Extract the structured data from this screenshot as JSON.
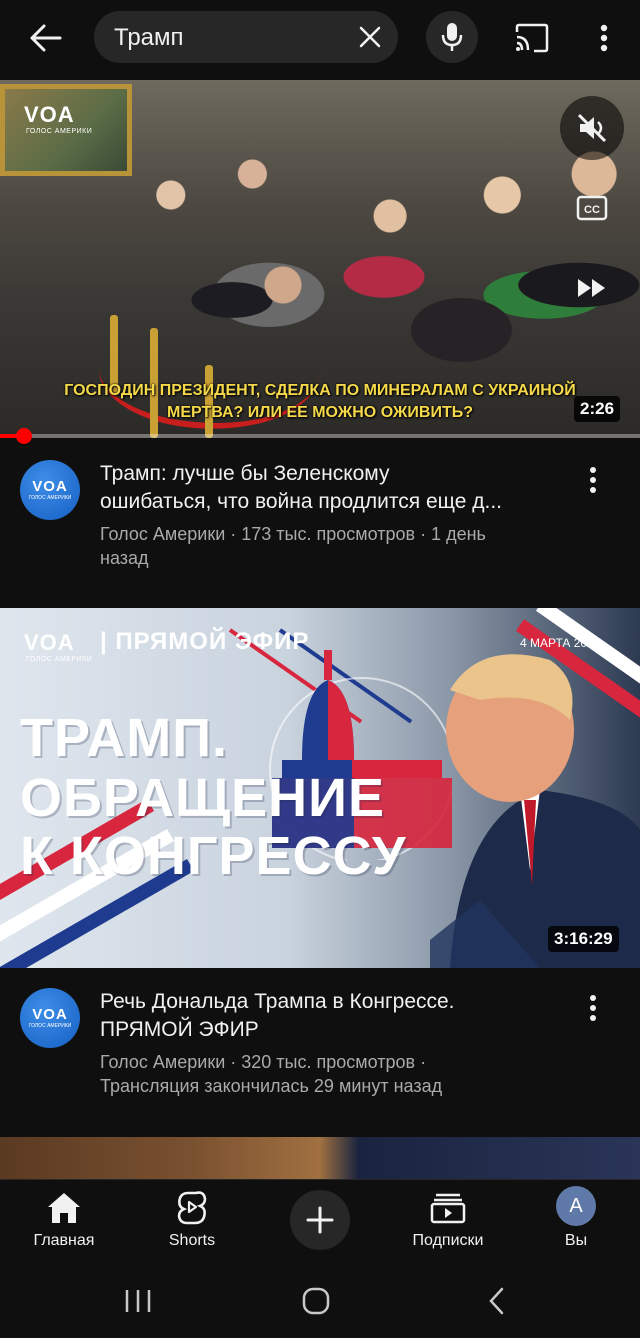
{
  "search": {
    "query": "Трамп"
  },
  "videos": [
    {
      "thumb_logo": "VOA",
      "thumb_logo_sub": "ГОЛОС АМЕРИКИ",
      "subtitle_line1": "ГОСПОДИН ПРЕЗИДЕНТ, СДЕЛКА ПО МИНЕРАЛАМ С УКРАИНОЙ",
      "subtitle_line2": "МЕРТВА? ИЛИ ЕЕ МОЖНО ОЖИВИТЬ?",
      "duration": "2:26",
      "progress_fraction": 0.025,
      "title_line1": "Трамп: лучше бы Зеленскому",
      "title_line2": "ошибаться, что война продлится еще д...",
      "channel": "Голос Америки",
      "views": "173 тыс. просмотров",
      "age": "1 день назад",
      "meta_line": "Голос Америки · 173 тыс. просмотров · 1 день",
      "meta_line2": "назад",
      "avatar_text": "VOA",
      "avatar_sub": "ГОЛОС АМЕРИКИ"
    },
    {
      "thumb_logo": "VOA",
      "thumb_logo_sub": "ГОЛОС АМЕРИКИ",
      "live_label": "| ПРЯМОЙ ЭФИР",
      "date_label": "4 МАРТА 2025",
      "big_title_1": "ТРАМП.",
      "big_title_2": "ОБРАЩЕНИЕ",
      "big_title_3": "К КОНГРЕССУ",
      "duration": "3:16:29",
      "title_line1": "Речь Дональда Трампа в Конгрессе.",
      "title_line2": "ПРЯМОЙ ЭФИР",
      "meta_line": "Голос Америки · 320 тыс. просмотров ·",
      "meta_line2": "Трансляция закончилась 29 минут назад",
      "avatar_text": "VOA",
      "avatar_sub": "ГОЛОС АМЕРИКИ"
    }
  ],
  "bottom_nav": {
    "home": "Главная",
    "shorts": "Shorts",
    "subscriptions": "Подписки",
    "you": "Вы",
    "you_avatar_letter": "A"
  },
  "colors": {
    "background": "#0f0f0f",
    "accent": "#ff0000",
    "subtitle_yellow": "#f5d94a",
    "channel_blue": "#1660c4"
  },
  "icons": [
    "back-arrow-icon",
    "close-icon",
    "mic-icon",
    "cast-icon",
    "more-vert-icon",
    "mute-icon",
    "captions-icon",
    "fast-forward-icon",
    "home-icon",
    "shorts-icon",
    "add-icon",
    "subscriptions-icon"
  ]
}
